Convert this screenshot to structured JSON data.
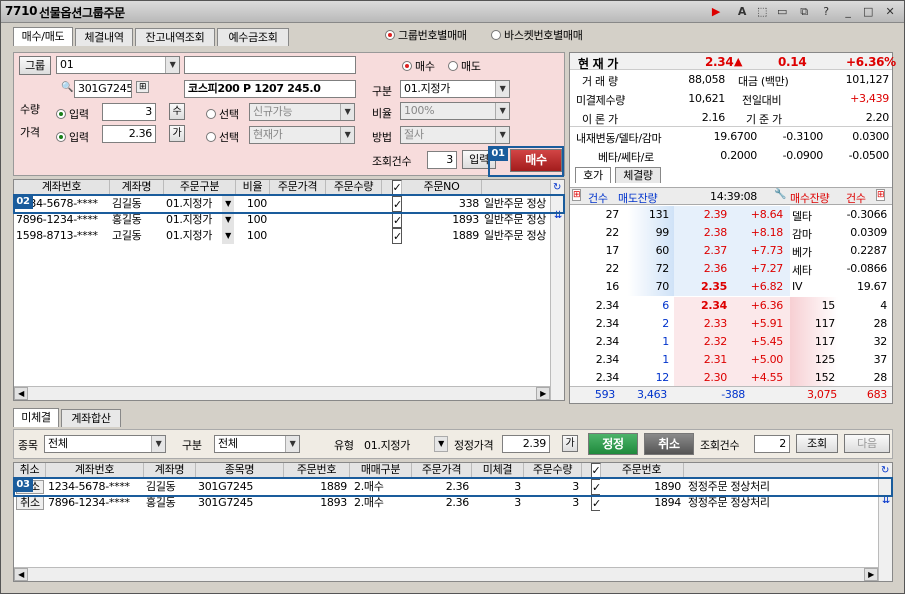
{
  "title": {
    "code": "7710",
    "name": "선물옵션그룹주문"
  },
  "tabs": [
    "매수/매도",
    "체결내역",
    "잔고내역조회",
    "예수금조회"
  ],
  "mode": {
    "opt1": "그룹번호별매매",
    "opt2": "바스켓번호별매매"
  },
  "form": {
    "group_btn": "그룹",
    "group_value": "01",
    "side_buy": "매수",
    "side_sell": "매도",
    "code": "301G7245",
    "code_name": "코스피200 P 1207 245.0",
    "type_label": "구분",
    "type_value": "01.지정가",
    "ratio_label": "비율",
    "ratio_value": "100%",
    "method_label": "방법",
    "method_value": "절사",
    "qty_label": "수량",
    "qty_opt": "입력",
    "qty_value": "3",
    "qty_btn": "수",
    "price_label": "가격",
    "price_opt": "입력",
    "price_value": "2.36",
    "price_btn": "가",
    "select1": "선택",
    "select1_value": "신규가능",
    "select2": "선택",
    "select2_value": "현재가",
    "count_label": "조회건수",
    "count_value": "3",
    "inquire_btn": "입력",
    "buy_btn": "매수"
  },
  "order_grid": {
    "headers": [
      "계좌번호",
      "계좌명",
      "주문구분",
      "비율",
      "주문가격",
      "주문수량",
      "✓",
      "주문NO"
    ],
    "rows": [
      {
        "acct": "1234-5678-****",
        "name": "김길동",
        "type": "01.지정가",
        "ratio": "100",
        "price": "",
        "qty": "",
        "chk": "✓",
        "no": "338",
        "memo": "일반주문 정상"
      },
      {
        "acct": "7896-1234-****",
        "name": "홍길동",
        "type": "01.지정가",
        "ratio": "100",
        "price": "",
        "qty": "",
        "chk": "✓",
        "no": "1893",
        "memo": "일반주문 정상"
      },
      {
        "acct": "1598-8713-****",
        "name": "고길동",
        "type": "01.지정가",
        "ratio": "100",
        "price": "",
        "qty": "",
        "chk": "✓",
        "no": "1889",
        "memo": "일반주문 정상"
      }
    ]
  },
  "quote_top": {
    "cur_label": "현 재 가",
    "cur": "2.34",
    "chg": "0.14",
    "pct": "+6.36%",
    "rows": [
      [
        "거 래 량",
        "88,058",
        "대금 (백만)",
        "101,127"
      ],
      [
        "미결제수량",
        "10,621",
        "전일대비",
        "+3,439"
      ],
      [
        "이 론 가",
        "2.16",
        "기 준 가",
        "2.20"
      ]
    ],
    "greeks_label": "내재변동/델타/감마",
    "greeks": [
      "19.6700",
      "-0.3100",
      "0.0300"
    ],
    "greeks2_label": "베타/쎄타/로",
    "greeks2": [
      "0.2000",
      "-0.0900",
      "-0.0500"
    ]
  },
  "book": {
    "h_count": "건수",
    "h_sell": "매도잔량",
    "time": "14:39:08",
    "h_buy": "매수잔량",
    "h_count2": "건수",
    "asks": [
      {
        "cnt": "27",
        "qty": "131",
        "price": "2.39",
        "chg": "+8.64",
        "k": "델타",
        "v": "-0.3066"
      },
      {
        "cnt": "22",
        "qty": "99",
        "price": "2.38",
        "chg": "+8.18",
        "k": "감마",
        "v": "0.0309"
      },
      {
        "cnt": "17",
        "qty": "60",
        "price": "2.37",
        "chg": "+7.73",
        "k": "베가",
        "v": "0.2287"
      },
      {
        "cnt": "22",
        "qty": "72",
        "price": "2.36",
        "chg": "+7.27",
        "k": "세타",
        "v": "-0.0866"
      },
      {
        "cnt": "16",
        "qty": "70",
        "price": "2.35",
        "chg": "+6.82",
        "k": "IV",
        "v": "19.67"
      }
    ],
    "bids": [
      {
        "p0": "2.34",
        "q0": "6",
        "price": "2.34",
        "chg": "+6.36",
        "qty": "15",
        "cnt": "4"
      },
      {
        "p0": "2.34",
        "q0": "2",
        "price": "2.33",
        "chg": "+5.91",
        "qty": "117",
        "cnt": "28"
      },
      {
        "p0": "2.34",
        "q0": "1",
        "price": "2.32",
        "chg": "+5.45",
        "qty": "117",
        "cnt": "32"
      },
      {
        "p0": "2.34",
        "q0": "1",
        "price": "2.31",
        "chg": "+5.00",
        "qty": "125",
        "cnt": "37"
      },
      {
        "p0": "2.34",
        "q0": "12",
        "price": "2.30",
        "chg": "+4.55",
        "qty": "152",
        "cnt": "28"
      }
    ],
    "tot": {
      "a": "593",
      "b": "3,463",
      "c": "-388",
      "d": "3,075",
      "e": "683"
    },
    "tab1": "호가",
    "tab2": "체결량"
  },
  "bottom_tabs": [
    "미체결",
    "계좌합산"
  ],
  "filter": {
    "item_label": "종목",
    "item_value": "전체",
    "type_label": "구분",
    "type_value": "전체",
    "kind_label": "유형",
    "kind_value": "01.지정가",
    "price_label": "정정가격",
    "price_value": "2.39",
    "price_btn": "가",
    "correct_btn": "정정",
    "cancel_btn": "취소",
    "count_label": "조회건수",
    "count_value": "2",
    "inquire_btn": "조회",
    "next_btn": "다음"
  },
  "pending_grid": {
    "headers": [
      "취소",
      "계좌번호",
      "계좌명",
      "종목명",
      "주문번호",
      "매매구분",
      "주문가격",
      "미체결",
      "주문수량",
      "✓",
      "주문번호"
    ],
    "rows": [
      {
        "cancel": "취소",
        "acct": "1234-5678-****",
        "name": "김길동",
        "item": "301G7245",
        "no": "1889",
        "side": "2.매수",
        "price": "2.36",
        "unfilled": "3",
        "qty": "3",
        "chk": "✓",
        "ono": "1890",
        "memo": "정정주문 정상처리"
      },
      {
        "cancel": "취소",
        "acct": "7896-1234-****",
        "name": "홍길동",
        "item": "301G7245",
        "no": "1893",
        "side": "2.매수",
        "price": "2.36",
        "unfilled": "3",
        "qty": "3",
        "chk": "✓",
        "ono": "1894",
        "memo": "정정주문 정상처리"
      }
    ]
  },
  "badges": [
    "01",
    "02",
    "03"
  ],
  "colors": {
    "accent": "#1a5c9c",
    "buy": "#c62828",
    "pink": "#f7dcdc"
  }
}
